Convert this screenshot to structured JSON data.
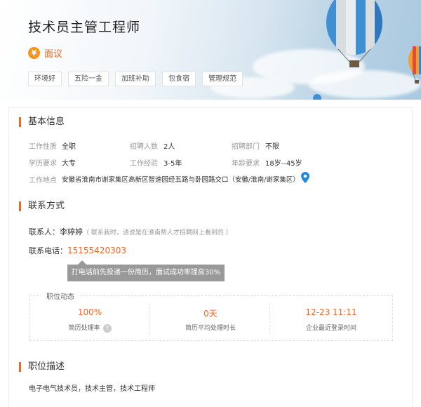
{
  "header": {
    "job_title": "技术员主管工程师",
    "salary_icon": "¥",
    "salary_text": "面议",
    "tags": [
      "环境好",
      "五险一金",
      "加班补助",
      "包食宿",
      "管理规范"
    ]
  },
  "basic_info": {
    "title": "基本信息",
    "fields": [
      {
        "label": "工作性质",
        "value": "全职"
      },
      {
        "label": "招聘人数",
        "value": "2人"
      },
      {
        "label": "招聘部门",
        "value": "不限"
      },
      {
        "label": "学历要求",
        "value": "大专"
      },
      {
        "label": "工作经验",
        "value": "3-5年"
      },
      {
        "label": "年龄要求",
        "value": "18岁--45岁"
      }
    ],
    "location_label": "工作地点",
    "location_value": "安徽省淮南市谢家集区高新区智速园经五路与卧园路交口（安徽/淮南/谢家集区）"
  },
  "contact": {
    "title": "联系方式",
    "person_label": "联系人：",
    "person_name": "李婷婷",
    "person_note": "（ 联系我时，请说是在淮南帮人才招聘网上看到的 ）",
    "phone_label": "联系电话：",
    "phone": "15155420303",
    "tooltip": "打电话前先投递一份简历，面试成功率提高30%"
  },
  "dynamics": {
    "title": "职位动态",
    "stats": [
      {
        "value": "100%",
        "label": "简历处理率"
      },
      {
        "value": "0天",
        "label": "简历平均处理时长"
      },
      {
        "value": "12-23 11:11",
        "label": "企业最近登录时间"
      }
    ]
  },
  "description": {
    "title": "职位描述",
    "text": "电子电气技术员，技术主管，技术工程师"
  },
  "colors": {
    "accent": "#f26522",
    "icon": "#f7941d",
    "location_pin": "#1e88e5"
  }
}
